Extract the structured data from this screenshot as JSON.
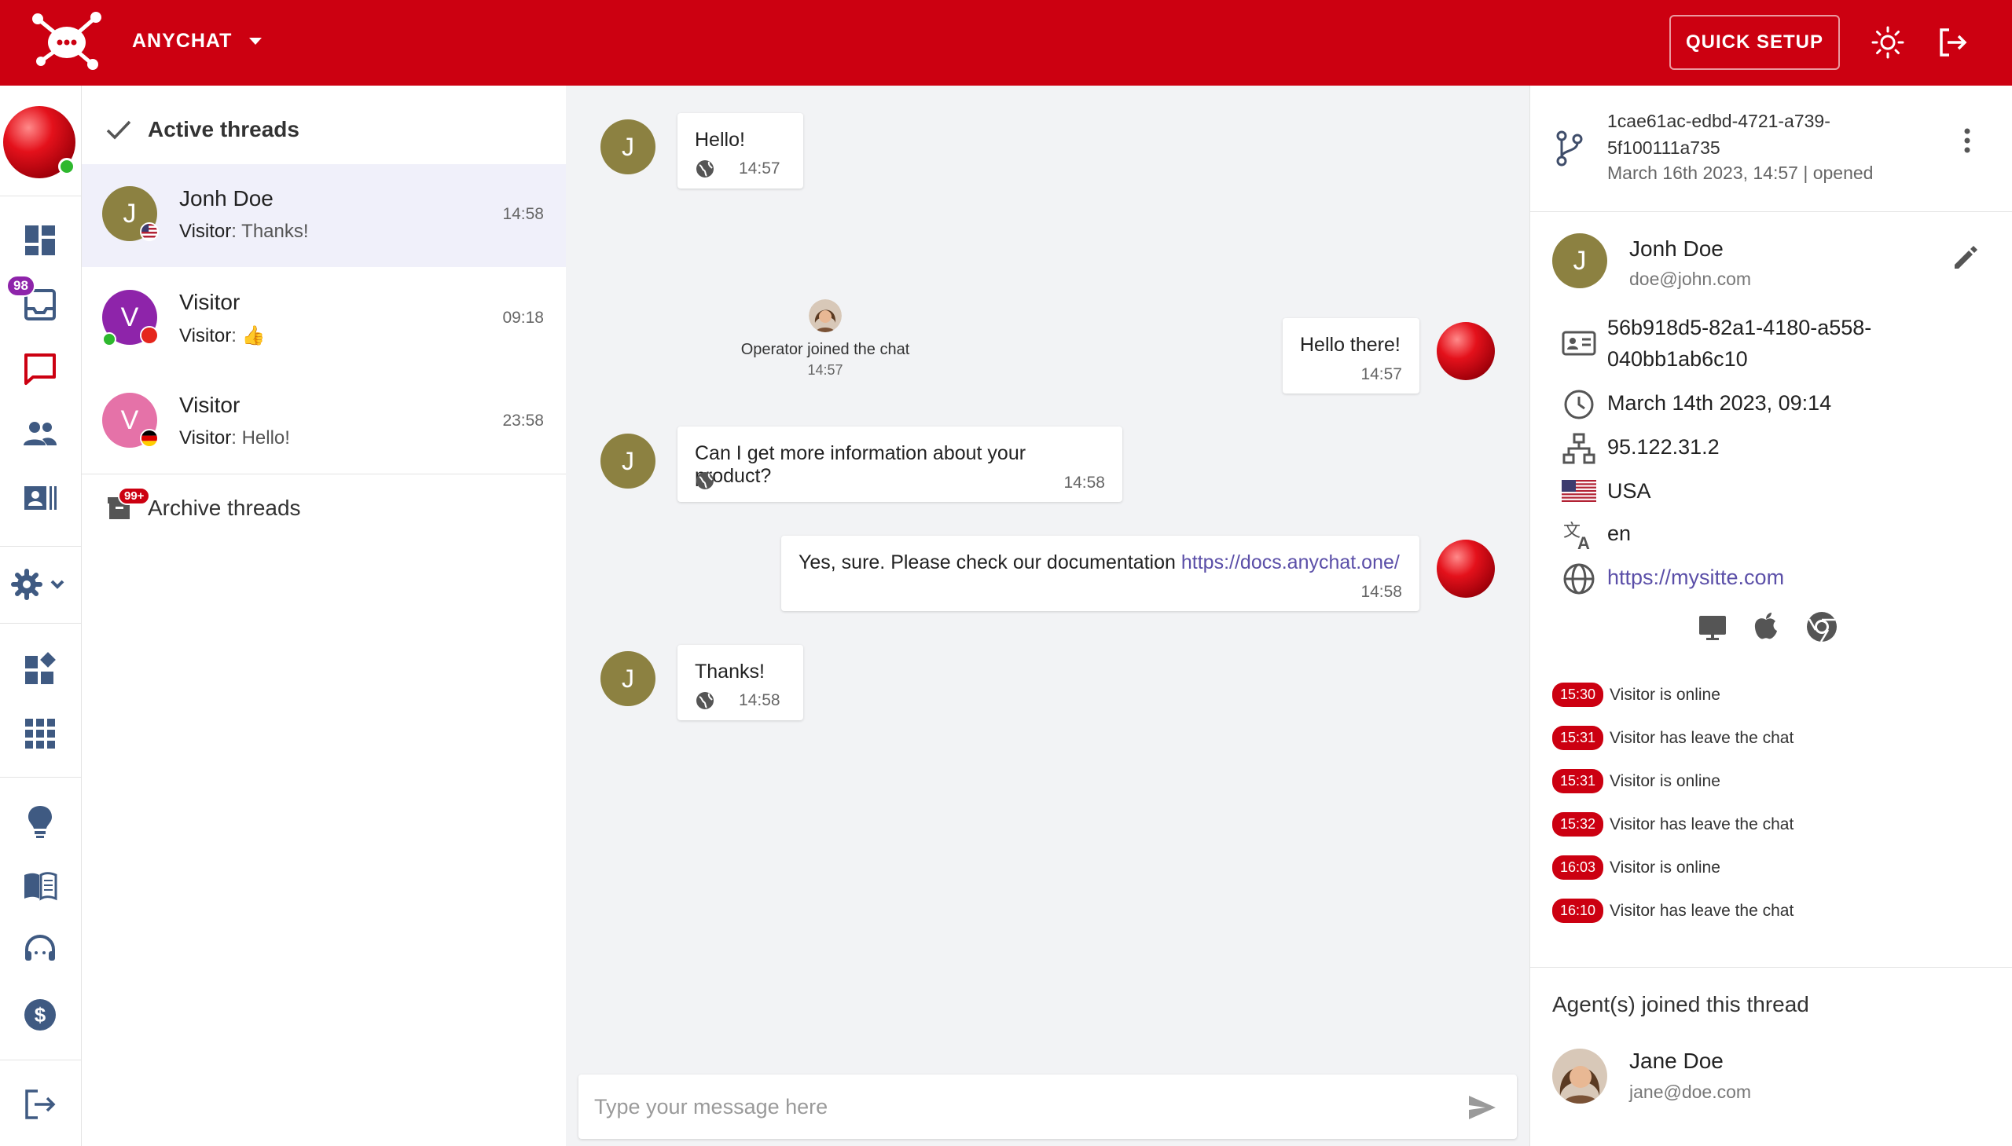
{
  "topbar": {
    "app_name": "ANYCHAT",
    "quick_setup_label": "QUICK SETUP"
  },
  "rail": {
    "inbox_badge": "98"
  },
  "threads": {
    "active_title": "Active threads",
    "archive_title": "Archive threads",
    "archive_badge": "99+",
    "items": [
      {
        "initial": "J",
        "name": "Jonh Doe",
        "sender": "Visitor",
        "message": ": Thanks!",
        "time": "14:58",
        "avatar_color": "#8c8141",
        "flag": "us"
      },
      {
        "initial": "V",
        "name": "Visitor",
        "sender": "Visitor",
        "message": ": 👍",
        "time": "09:18",
        "avatar_color": "#8e24aa",
        "flag": "other"
      },
      {
        "initial": "V",
        "name": "Visitor",
        "sender": "Visitor",
        "message": ": Hello!",
        "time": "23:58",
        "avatar_color": "#e572a8",
        "flag": "de"
      }
    ]
  },
  "chat": {
    "messages": [
      {
        "side": "visitor",
        "initial": "J",
        "text": "Hello!",
        "time": "14:57"
      },
      {
        "side": "system",
        "text": "Operator joined the chat",
        "time": "14:57"
      },
      {
        "side": "operator",
        "text": "Hello there!",
        "time": "14:57"
      },
      {
        "side": "visitor",
        "initial": "J",
        "text": "Can I get more information about your product?",
        "time": "14:58"
      },
      {
        "side": "operator",
        "text": "Yes, sure. Please check our documentation ",
        "link": "https://docs.anychat.one/",
        "time": "14:58"
      },
      {
        "side": "visitor",
        "initial": "J",
        "text": "Thanks!",
        "time": "14:58"
      }
    ],
    "composer_placeholder": "Type your message here"
  },
  "info": {
    "thread_id": "1cae61ac-edbd-4721-a739-5f100111a735",
    "thread_meta": "March 16th 2023, 14:57 | opened",
    "visitor": {
      "initial": "J",
      "name": "Jonh Doe",
      "email": "doe@john.com",
      "id": "56b918d5-82a1-4180-a558-040bb1ab6c10",
      "date": "March 14th 2023, 09:14",
      "ip": "95.122.31.2",
      "country": "USA",
      "language": "en",
      "url": "https://mysitte.com"
    },
    "events": [
      {
        "time": "15:30",
        "text": "Visitor is online"
      },
      {
        "time": "15:31",
        "text": "Visitor has leave the chat"
      },
      {
        "time": "15:31",
        "text": "Visitor is online"
      },
      {
        "time": "15:32",
        "text": "Visitor has leave the chat"
      },
      {
        "time": "16:03",
        "text": "Visitor is online"
      },
      {
        "time": "16:10",
        "text": "Visitor has leave the chat"
      }
    ],
    "agents_title": "Agent(s) joined this thread",
    "agent": {
      "name": "Jane Doe",
      "email": "jane@doe.com"
    }
  },
  "colors": {
    "brand": "#cc0011",
    "accent_purple": "#8e24aa",
    "link": "#5b4fa8"
  }
}
